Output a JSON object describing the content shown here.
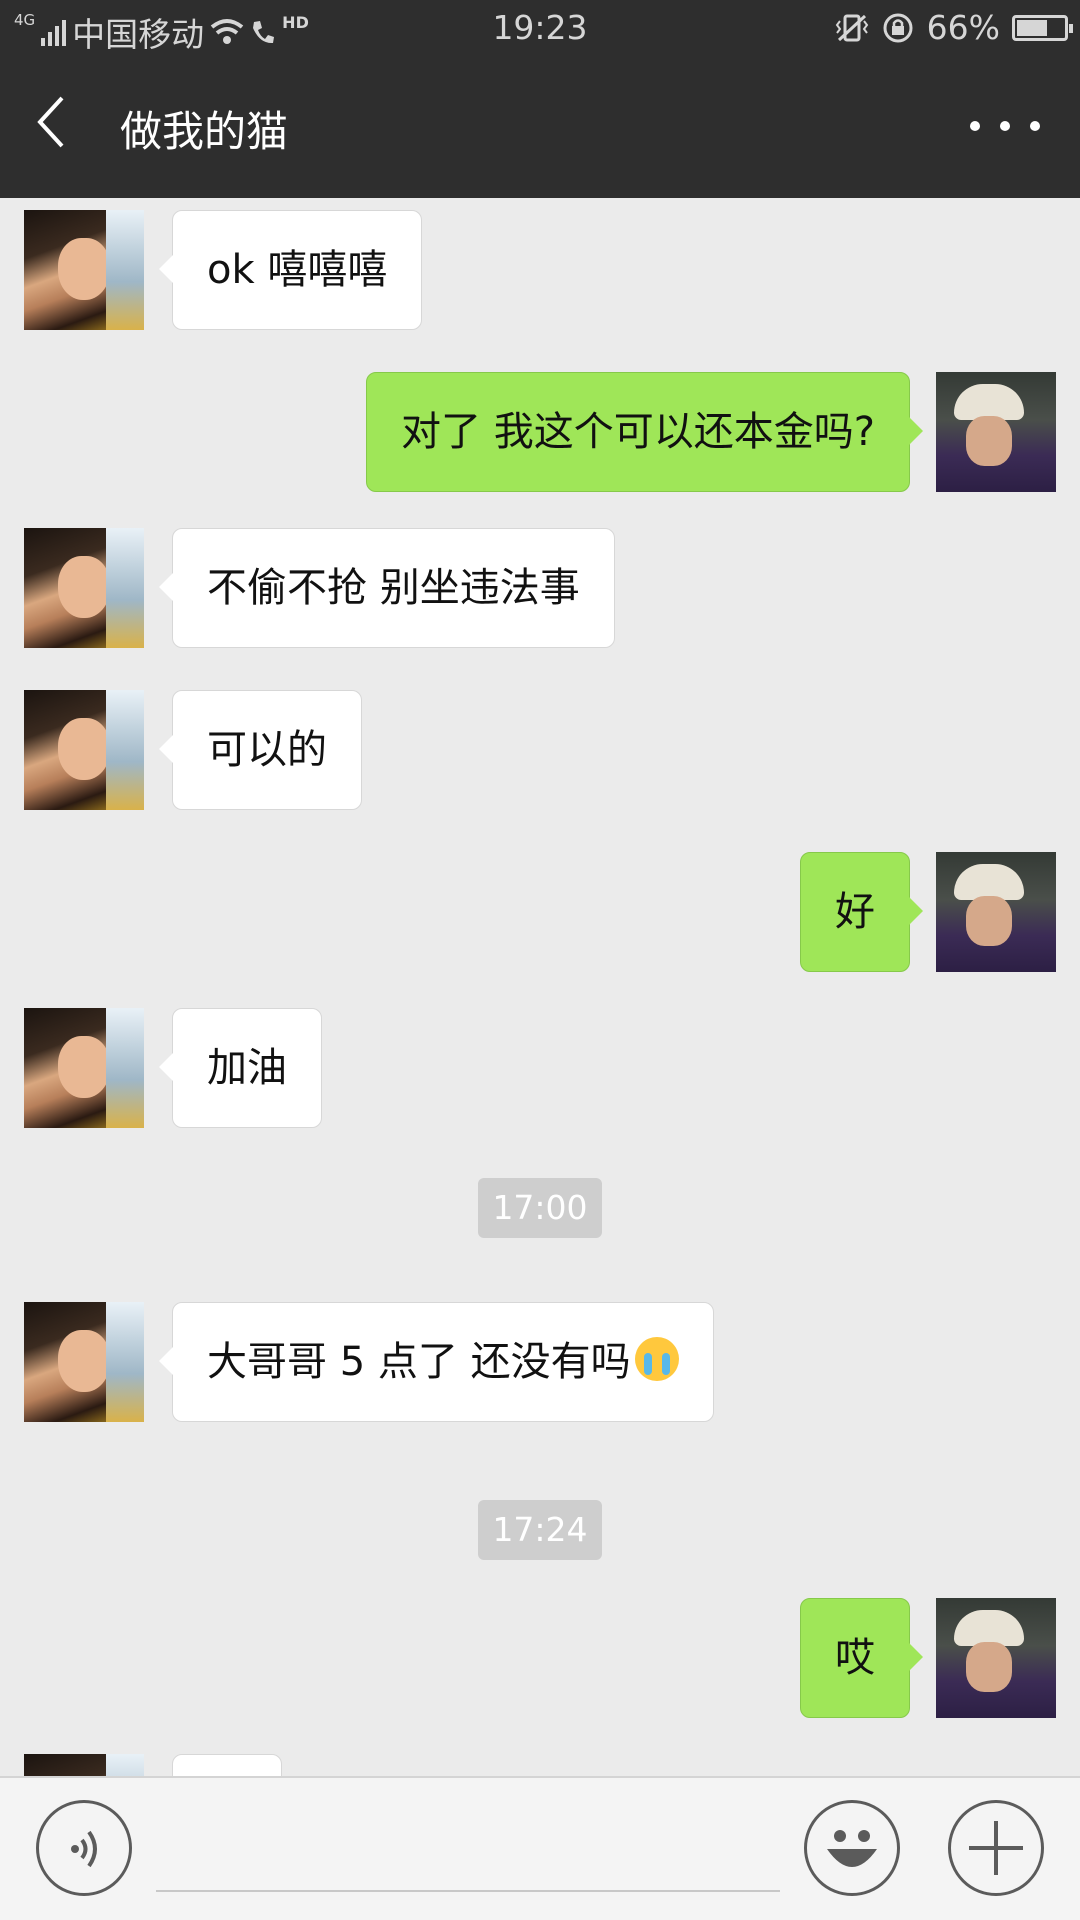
{
  "status_bar": {
    "network": "4G",
    "carrier": "中国移动",
    "call_badge": "HD",
    "time": "19:23",
    "battery_text": "66%",
    "battery_level": 0.66
  },
  "header": {
    "title": "做我的猫"
  },
  "messages": [
    {
      "side": "received",
      "text": "ok 嘻嘻嘻"
    },
    {
      "side": "sent",
      "text": "对了  我这个可以还本金吗?"
    },
    {
      "side": "received",
      "text": "不偷不抢 别坐违法事"
    },
    {
      "side": "received",
      "text": "可以的"
    },
    {
      "side": "sent",
      "text": "好"
    },
    {
      "side": "received",
      "text": "加油"
    },
    {
      "side": "received",
      "text": "大哥哥 5 点了 还没有吗",
      "emoji": "loudly-crying-face"
    },
    {
      "side": "sent",
      "text": "哎"
    }
  ],
  "timestamps": [
    "17:00",
    "17:24"
  ],
  "input_bar": {
    "icons": [
      "voice-icon",
      "emoji-icon",
      "plus-icon"
    ]
  },
  "colors": {
    "bar_bg": "#2e2e2e",
    "chat_bg": "#ebebeb",
    "sent_bubble": "#9fe658",
    "received_bubble": "#ffffff"
  }
}
